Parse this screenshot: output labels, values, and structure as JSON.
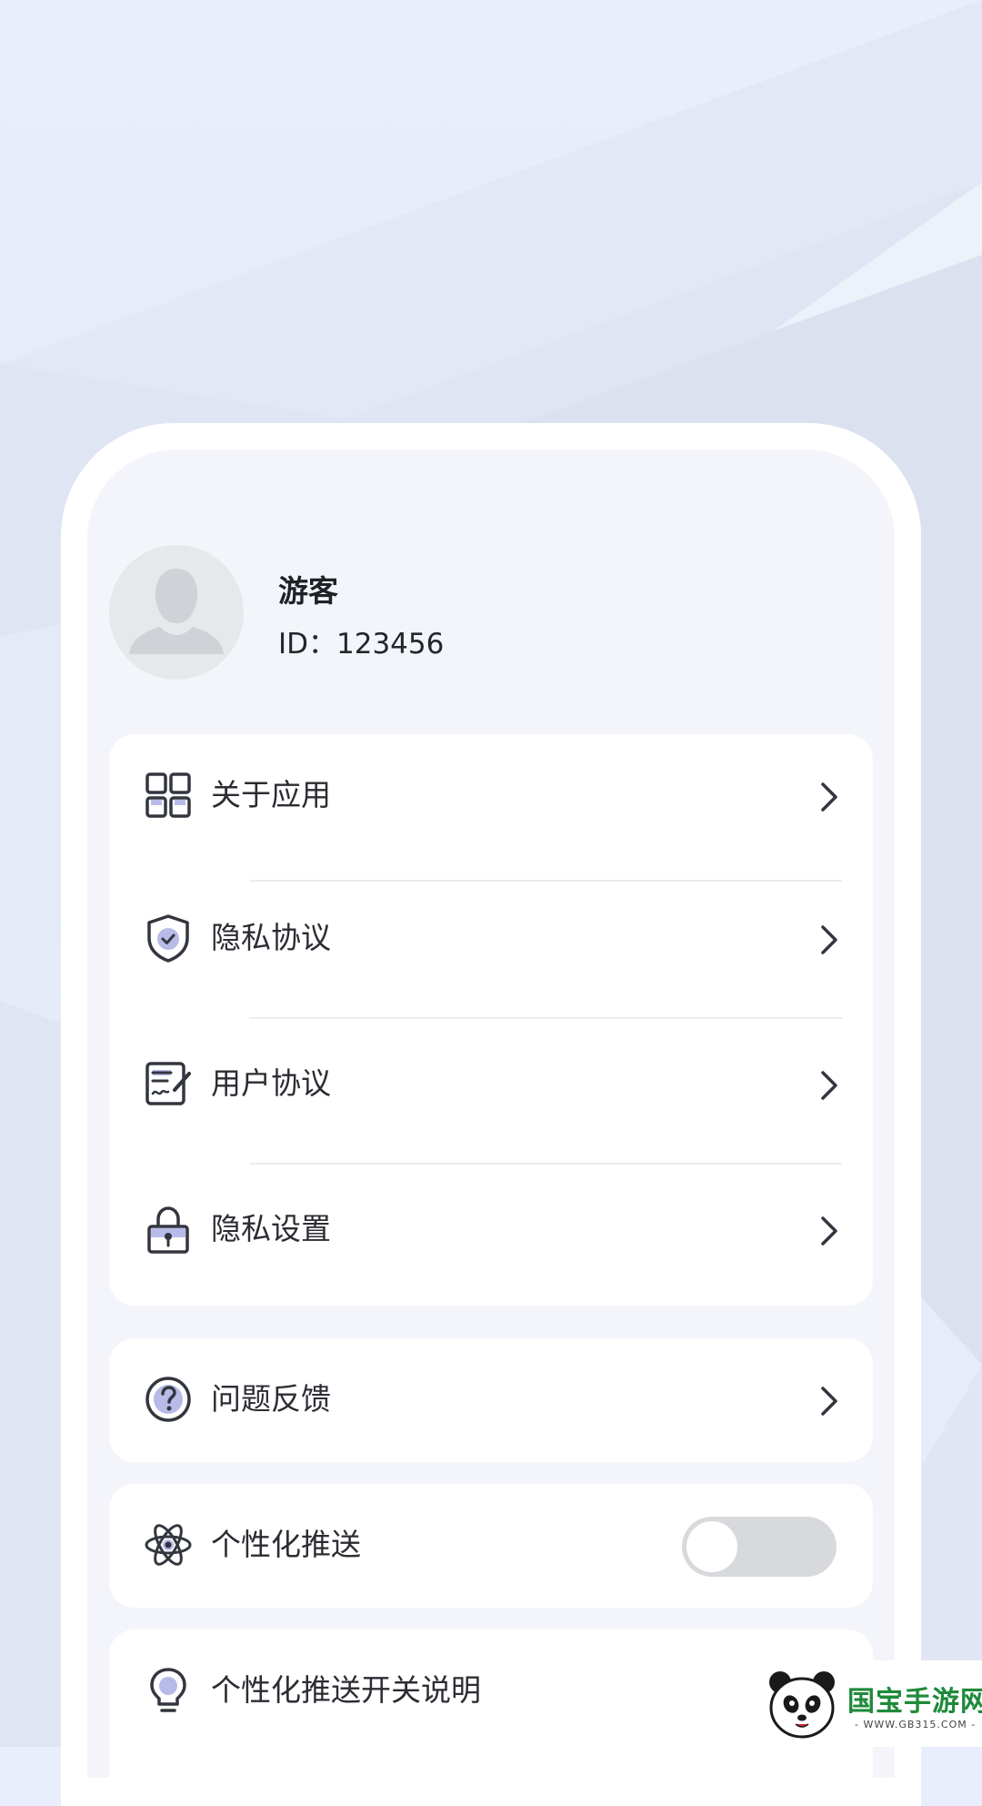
{
  "profile": {
    "name": "游客",
    "id_text": "ID：123456"
  },
  "menu": {
    "about": "关于应用",
    "privacy_policy": "隐私协议",
    "user_agreement": "用户协议",
    "privacy_settings": "隐私设置"
  },
  "feedback": {
    "label": "问题反馈"
  },
  "personalized_push": {
    "label": "个性化推送",
    "enabled": false
  },
  "push_explain": {
    "label": "个性化推送开关说明"
  },
  "watermark": {
    "brand": "国宝手游网",
    "url": "- WWW.GB315.COM -"
  },
  "colors": {
    "text_primary": "#2b2d33",
    "icon_dark": "#33363f",
    "toggle_off": "#d8d9dc"
  }
}
